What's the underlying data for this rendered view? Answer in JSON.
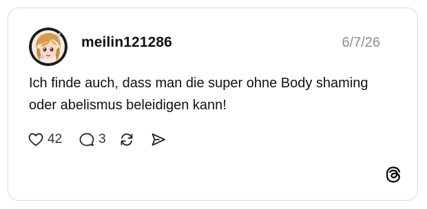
{
  "post": {
    "username": "meilin121286",
    "date": "6/7/26",
    "text": "Ich finde auch, dass man die super ohne Body shaming oder abelismus beleidigen kann!",
    "likes": "42",
    "replies": "3"
  },
  "icons": {
    "avatar": "anime-character-avatar",
    "like": "heart-icon",
    "reply": "comment-bubble-icon",
    "repost": "repost-arrows-icon",
    "share": "send-icon",
    "brand": "threads-logo-icon"
  }
}
